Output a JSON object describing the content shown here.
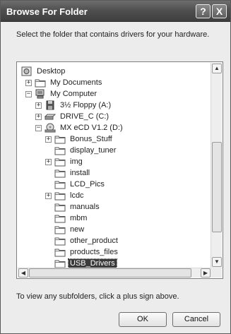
{
  "window": {
    "title": "Browse For Folder",
    "help_button": "?",
    "close_button": "X"
  },
  "instruction": "Select the folder that contains drivers for your hardware.",
  "tree": {
    "nodes": [
      {
        "label": "Desktop",
        "icon": "desktop-icon",
        "expander": "",
        "depth": 0
      },
      {
        "label": "My Documents",
        "icon": "folder-icon",
        "expander": "+",
        "depth": 1
      },
      {
        "label": "My Computer",
        "icon": "computer-icon",
        "expander": "−",
        "depth": 1
      },
      {
        "label": "3½ Floppy (A:)",
        "icon": "floppy-icon",
        "expander": "+",
        "depth": 2
      },
      {
        "label": "DRIVE_C (C:)",
        "icon": "hard-drive-icon",
        "expander": "+",
        "depth": 2
      },
      {
        "label": "MX eCD V1.2 (D:)",
        "icon": "cd-drive-icon",
        "expander": "−",
        "depth": 2
      },
      {
        "label": "Bonus_Stuff",
        "icon": "folder-icon",
        "expander": "+",
        "depth": 3
      },
      {
        "label": "display_tuner",
        "icon": "folder-icon",
        "expander": "",
        "depth": 3
      },
      {
        "label": "img",
        "icon": "folder-icon",
        "expander": "+",
        "depth": 3
      },
      {
        "label": "install",
        "icon": "folder-icon",
        "expander": "",
        "depth": 3
      },
      {
        "label": "LCD_Pics",
        "icon": "folder-icon",
        "expander": "",
        "depth": 3
      },
      {
        "label": "lcdc",
        "icon": "folder-icon",
        "expander": "+",
        "depth": 3
      },
      {
        "label": "manuals",
        "icon": "folder-icon",
        "expander": "",
        "depth": 3
      },
      {
        "label": "mbm",
        "icon": "folder-icon",
        "expander": "",
        "depth": 3
      },
      {
        "label": "new",
        "icon": "folder-icon",
        "expander": "",
        "depth": 3
      },
      {
        "label": "other_product",
        "icon": "folder-icon",
        "expander": "",
        "depth": 3
      },
      {
        "label": "products_files",
        "icon": "folder-icon",
        "expander": "",
        "depth": 3
      },
      {
        "label": "USB_Drivers",
        "icon": "folder-icon",
        "expander": "",
        "depth": 3,
        "selected": true
      }
    ]
  },
  "scroll_arrows": {
    "up": "▲",
    "down": "▼",
    "left": "◀",
    "right": "▶"
  },
  "hint": "To view any subfolders, click a plus sign above.",
  "buttons": {
    "ok": "OK",
    "cancel": "Cancel"
  }
}
